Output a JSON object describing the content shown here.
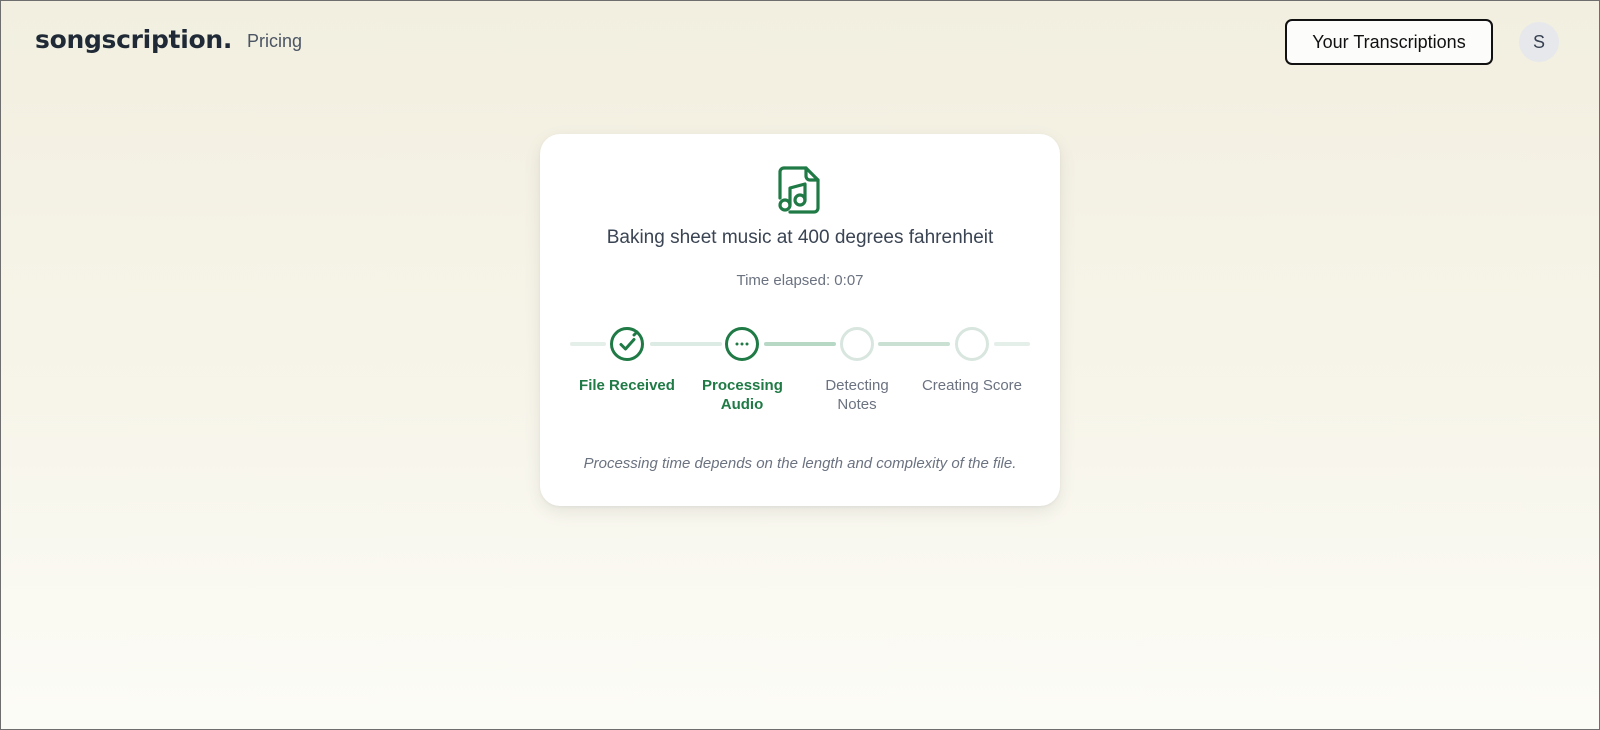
{
  "header": {
    "logo": "songscription.",
    "nav_link": "Pricing",
    "transcriptions_button": "Your Transcriptions",
    "avatar_initial": "S"
  },
  "card": {
    "icon": "music-file-icon",
    "headline": "Baking sheet music at 400 degrees fahrenheit",
    "elapsed": "Time elapsed: 0:07",
    "steps": [
      {
        "label": "File Received",
        "state": "done",
        "icon": "check-icon"
      },
      {
        "label": "Processing Audio",
        "state": "active",
        "icon": "ellipsis-icon"
      },
      {
        "label": "Detecting Notes",
        "state": "pending"
      },
      {
        "label": "Creating Score",
        "state": "pending"
      }
    ],
    "footnote": "Processing time depends on the length and complexity of the file."
  },
  "colors": {
    "accent_green": "#1f7a45",
    "pending_ring": "#d8e6df",
    "track_light": "#dcebe3",
    "track_active": "#b7d8c5"
  }
}
